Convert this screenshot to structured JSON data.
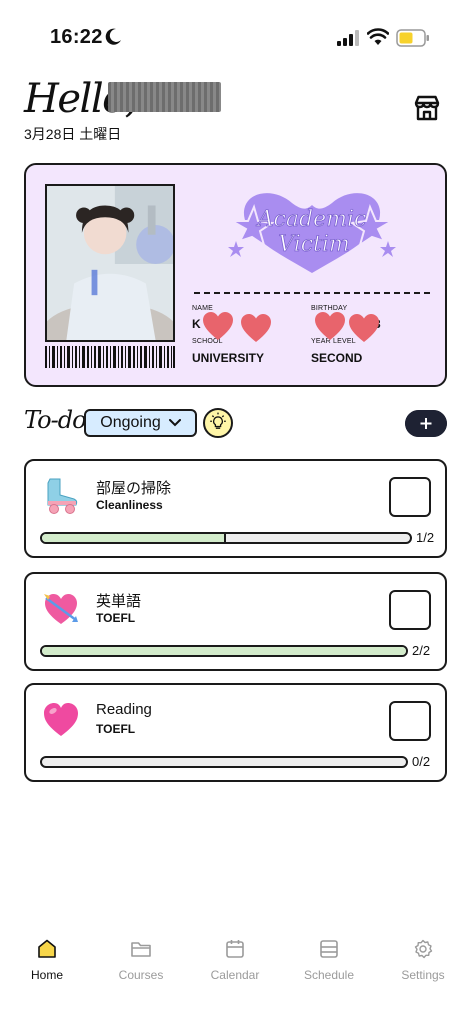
{
  "status_bar": {
    "time": "16:22"
  },
  "header": {
    "greeting": "Hello,",
    "date": "3月28日 土曜日"
  },
  "id_card": {
    "logo_line1": "Academic",
    "logo_line2": "Victim",
    "name_label": "NAME",
    "name_value": "K",
    "birthday_label": "BIRTHDAY",
    "birthday_value": "3",
    "school_label": "SCHOOL",
    "school_value": "UNIVERSITY",
    "year_label": "YEAR LEVEL",
    "year_value": "SECOND"
  },
  "todo": {
    "title": "To-do",
    "filter_label": "Ongoing"
  },
  "tasks": [
    {
      "title": "部屋の掃除",
      "subtitle": "Cleanliness",
      "count": "1/2",
      "progress": 0.5,
      "icon": "roller-skate-icon"
    },
    {
      "title": "英単語",
      "subtitle": "TOEFL",
      "count": "2/2",
      "progress": 1.0,
      "icon": "heart-arrow-icon"
    },
    {
      "title": "Reading",
      "subtitle": "TOEFL",
      "count": "0/2",
      "progress": 0.0,
      "icon": "pink-heart-icon"
    }
  ],
  "nav": [
    {
      "label": "Home",
      "icon": "home-icon",
      "active": true
    },
    {
      "label": "Courses",
      "icon": "folder-icon",
      "active": false
    },
    {
      "label": "Calendar",
      "icon": "calendar-icon",
      "active": false
    },
    {
      "label": "Schedule",
      "icon": "schedule-icon",
      "active": false
    },
    {
      "label": "Settings",
      "icon": "gear-icon",
      "active": false
    }
  ],
  "colors": {
    "card_bg": "#f3e6fd",
    "logo_purple": "#a98df0",
    "filter_bg": "#d7ecff",
    "bulb_bg": "#fff6a8",
    "progress_fill": "#d3eccb",
    "add_button_bg": "#1e2233",
    "home_icon_fill": "#f7d64a",
    "redaction_heart": "#e8646c"
  }
}
